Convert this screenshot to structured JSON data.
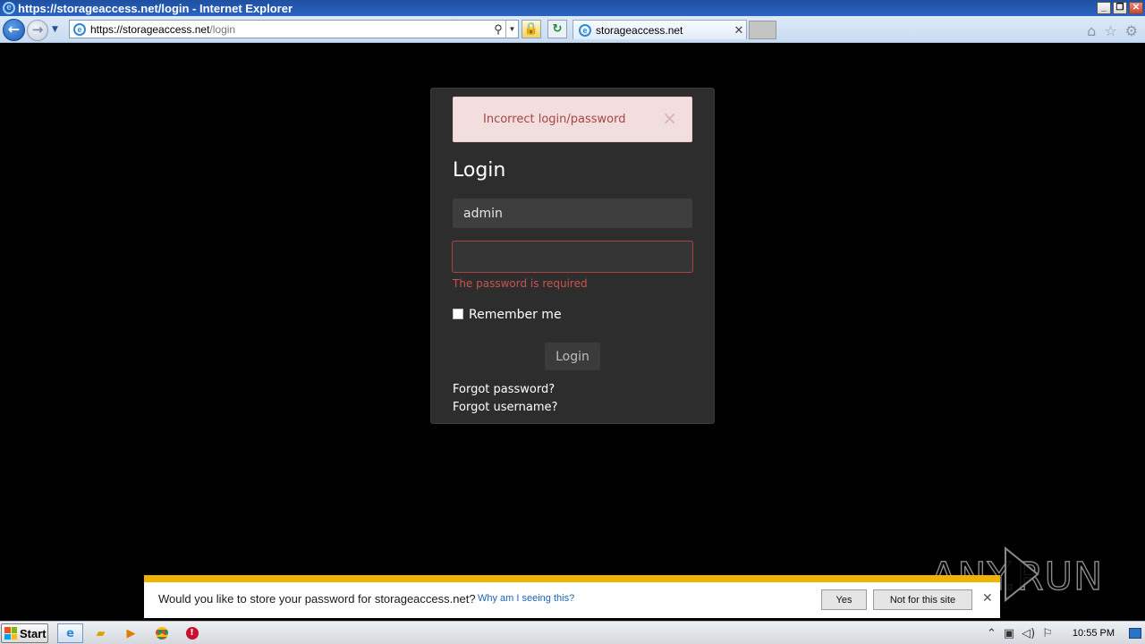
{
  "window": {
    "title": "https://storageaccess.net/login - Internet Explorer",
    "minimize": "_",
    "restore": "❐",
    "close": "✕"
  },
  "navbar": {
    "url_host": "https://storageaccess.net",
    "url_path": "/login",
    "tab_title": "storageaccess.net",
    "tab_close": "✕"
  },
  "login": {
    "alert_message": "Incorrect login/password",
    "alert_close": "×",
    "title": "Login",
    "username_value": "admin",
    "password_value": "",
    "password_error": "The password is required",
    "remember_label": "Remember me",
    "remember_checked": false,
    "submit_label": "Login",
    "forgot_password": "Forgot password?",
    "forgot_username": "Forgot username?"
  },
  "notification": {
    "message": "Would you like to store your password for storageaccess.net?",
    "why_link": "Why am I seeing this?",
    "yes_label": "Yes",
    "no_label": "Not for this site",
    "close": "✕",
    "accent_color": "#f0b400"
  },
  "watermark": {
    "text": "ANY.RUN"
  },
  "taskbar": {
    "start_label": "Start",
    "clock": "10:55 PM"
  },
  "colors": {
    "error": "#a94442",
    "alert_bg": "#f2dede",
    "card_bg": "#2d2d2d"
  }
}
